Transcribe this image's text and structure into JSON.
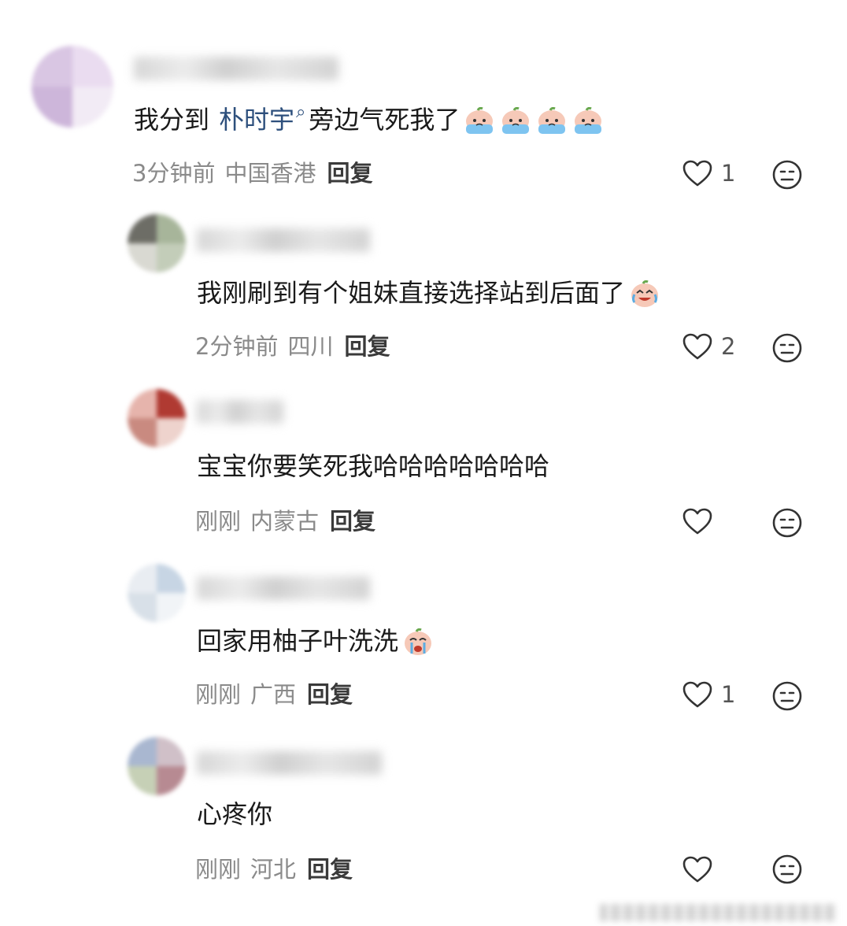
{
  "comments": [
    {
      "text_before": "我分到",
      "mention": "朴时宇",
      "text_after": "旁边气死我了",
      "stickers": [
        "crying-peach-sticker",
        "crying-peach-sticker",
        "crying-peach-sticker",
        "crying-peach-sticker"
      ],
      "time": "3分钟前",
      "location": "中国香港",
      "reply_label": "回复",
      "likes": "1"
    },
    {
      "text": "我刚刷到有个姐妹直接选择站到后面了",
      "stickers": [
        "laughing-crying-peach-sticker"
      ],
      "time": "2分钟前",
      "location": "四川",
      "reply_label": "回复",
      "likes": "2"
    },
    {
      "text": "宝宝你要笑死我哈哈哈哈哈哈哈",
      "stickers": [],
      "time": "刚刚",
      "location": "内蒙古",
      "reply_label": "回复",
      "likes": ""
    },
    {
      "text": "回家用柚子叶洗洗",
      "stickers": [
        "sobbing-peach-sticker"
      ],
      "time": "刚刚",
      "location": "广西",
      "reply_label": "回复",
      "likes": "1"
    },
    {
      "text": "心疼你",
      "stickers": [],
      "time": "刚刚",
      "location": "河北",
      "reply_label": "回复",
      "likes": ""
    }
  ],
  "colors": {
    "mention": "#2d4f7c",
    "meta_text": "#8a8a8a",
    "reply_text": "#3a3a3a",
    "body_text": "#1a1a1a"
  }
}
